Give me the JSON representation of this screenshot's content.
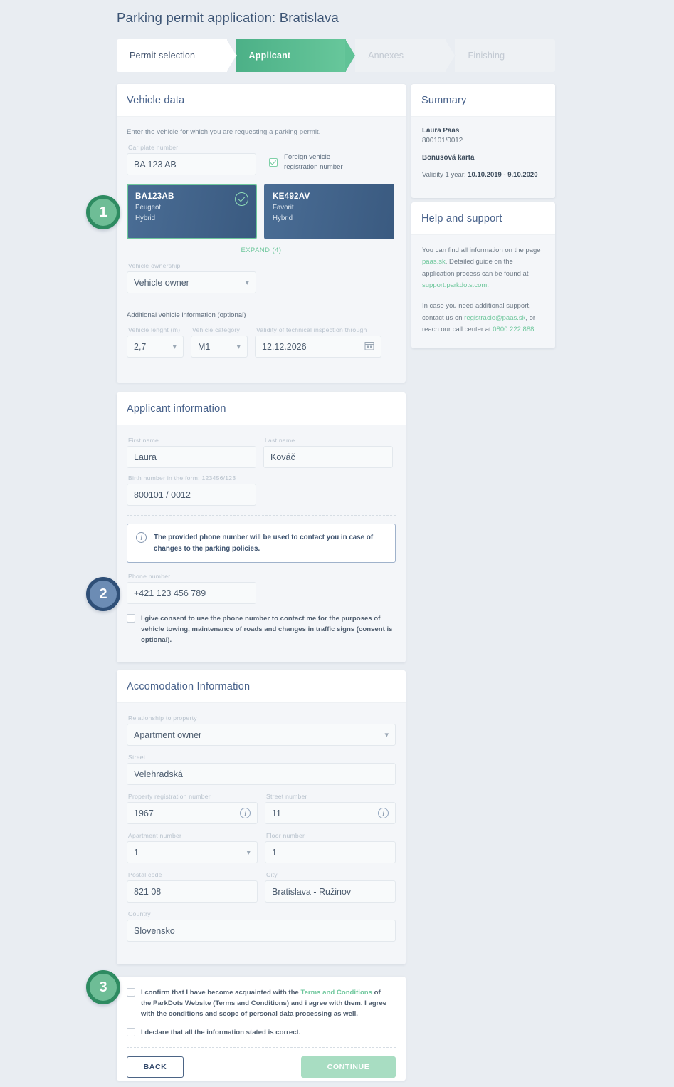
{
  "page": {
    "title": "Parking permit application: Bratislava"
  },
  "stepper": {
    "steps": [
      {
        "label": "Permit selection",
        "state": "done"
      },
      {
        "label": "Applicant",
        "state": "active"
      },
      {
        "label": "Annexes",
        "state": "idle"
      },
      {
        "label": "Finishing",
        "state": "idle"
      }
    ]
  },
  "markers": [
    {
      "number": "1",
      "color": "#2e8b61"
    },
    {
      "number": "2",
      "color": "#2f4f77"
    },
    {
      "number": "3",
      "color": "#2e8b61"
    }
  ],
  "vehicle": {
    "heading": "Vehicle data",
    "hint": "Enter the vehicle for which you are requesting a parking permit.",
    "plate_label": "Car plate number",
    "plate_value": "BA 123 AB",
    "foreign_checkbox_label": "Foreign vehicle registration number",
    "foreign_checked": true,
    "cards": [
      {
        "plate": "BA123AB",
        "make": "Peugeot",
        "fuel": "Hybrid",
        "selected": true
      },
      {
        "plate": "KE492AV",
        "make": "Favorit",
        "fuel": "Hybrid",
        "selected": false
      }
    ],
    "expand_label": "EXPAND (4)",
    "ownership_label": "Vehicle ownership",
    "ownership_value": "Vehicle owner",
    "additional_label": "Additional vehicle information (optional)",
    "length_label": "Vehicle lenght (m)",
    "length_value": "2,7",
    "category_label": "Vehicle category",
    "category_value": "M1",
    "inspection_label": "Validity of technical inspection through",
    "inspection_value": "12.12.2026"
  },
  "applicant": {
    "heading": "Applicant information",
    "first_name_label": "First name",
    "first_name_value": "Laura",
    "last_name_label": "Last name",
    "last_name_value": "Kováč",
    "birth_label": "Birth number in the form: 123456/123",
    "birth_value": "800101 / 0012",
    "banner_text": "The provided phone number will be used to contact you in case of changes to the parking policies.",
    "phone_label": "Phone number",
    "phone_value": "+421 123 456 789",
    "consent_label": "I give consent to use the phone number to contact me for the purposes of vehicle towing, maintenance of roads and changes in traffic signs (consent is optional).",
    "consent_checked": false
  },
  "accommodation": {
    "heading": "Accomodation Information",
    "relationship_label": "Relationship to property",
    "relationship_value": "Apartment owner",
    "street_label": "Street",
    "street_value": "Velehradská",
    "property_reg_label": "Property registration number",
    "property_reg_value": "1967",
    "street_no_label": "Street number",
    "street_no_value": "11",
    "apartment_label": "Apartment number",
    "apartment_value": "1",
    "floor_label": "Floor number",
    "floor_value": "1",
    "postal_label": "Postal code",
    "postal_value": "821 08",
    "city_label": "City",
    "city_value": "Bratislava - Ružinov",
    "country_label": "Country",
    "country_value": "Slovensko"
  },
  "footer": {
    "terms_text_1": "I confirm that I have become acquainted with the ",
    "terms_link": "Terms and Conditions",
    "terms_text_2": " of the ParkDots Website (Terms and Conditions) and i agree with them. I agree with the conditions and scope of personal data processing as well.",
    "declare_text": "I declare that all the information stated is correct.",
    "back_label": "BACK",
    "continue_label": "CONTINUE"
  },
  "summary": {
    "heading": "Summary",
    "name": "Laura Paas",
    "birth_number": "800101/0012",
    "card_name": "Bonusová karta",
    "validity_label": "Validity 1 year:",
    "validity_value": "10.10.2019 - 9.10.2020"
  },
  "help": {
    "heading": "Help and support",
    "p1_a": "You can find all information on the page ",
    "p1_link1": "paas.sk",
    "p1_b": ". Detailed guide on the application process can be found at ",
    "p1_link2": "support.parkdots.com",
    "p1_c": ".",
    "p2_a": "In case you need additional support, contact us on ",
    "p2_link1": "registracie@paas.sk",
    "p2_b": ", or reach our call center at ",
    "p2_link2": "0800 222 888",
    "p2_c": "."
  }
}
